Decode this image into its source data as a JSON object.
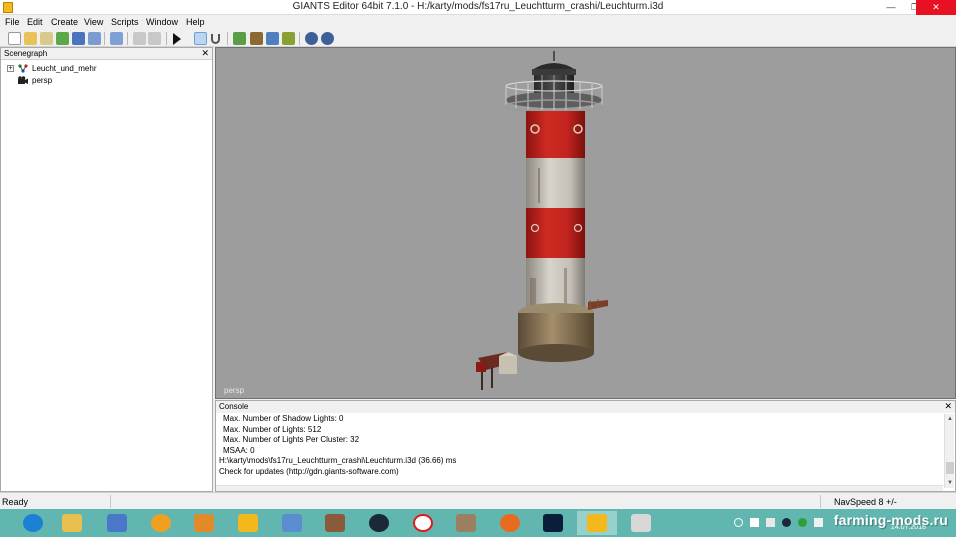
{
  "window": {
    "title": "GIANTS Editor 64bit 7.1.0 - H:/karty/mods/fs17ru_Leuchtturm_crashi/Leuchturm.i3d",
    "minimize_glyph": "—",
    "maximize_glyph": "❐",
    "close_glyph": "✕"
  },
  "menu": [
    {
      "label": "File"
    },
    {
      "label": "Edit"
    },
    {
      "label": "Create"
    },
    {
      "label": "View"
    },
    {
      "label": "Scripts"
    },
    {
      "label": "Window"
    },
    {
      "label": "Help"
    }
  ],
  "toolbar": {
    "icons": [
      "new-file-icon",
      "open-file-icon",
      "edit-file-icon",
      "refresh-icon",
      "save-icon",
      "export-icon",
      "history-icon",
      "undo-icon",
      "redo-icon",
      "play-icon",
      "select-icon",
      "magnet-icon",
      "terrain-icon",
      "paint-icon",
      "sculpt-icon",
      "foliage-icon",
      "settings-gear-icon",
      "settings-gear-2-icon"
    ]
  },
  "scenegraph": {
    "title": "Scenegraph",
    "close_glyph": "✕",
    "nodes": [
      {
        "label": "Leucht_und_mehr",
        "expander": "+",
        "icon": "transform-group-icon"
      },
      {
        "label": "persp",
        "icon": "camera-icon"
      }
    ]
  },
  "viewport": {
    "camera_label": "persp"
  },
  "console": {
    "title": "Console",
    "close_glyph": "✕",
    "lines": [
      "Max. Number of Shadow Lights: 0",
      "Max. Number of Lights: 512",
      "Max. Number of Lights Per Cluster: 32",
      "MSAA: 0",
      "H:\\karty\\mods\\fs17ru_Leuchtturm_crashi\\Leuchturm.i3d (36.66) ms",
      "Check for updates (http://gdn.giants-software.com)"
    ],
    "scroll_up_glyph": "▲",
    "scroll_down_glyph": "▼"
  },
  "status": {
    "ready": "Ready",
    "navspeed": "NavSpeed 8 +/-"
  },
  "taskbar": {
    "apps": [
      {
        "name": "ie",
        "icon": "internet-explorer-icon",
        "color": "#1e7fd6"
      },
      {
        "name": "explorer",
        "icon": "file-explorer-icon",
        "color": "#e8c050"
      },
      {
        "name": "paint",
        "icon": "paint-app-icon",
        "color": "#4a78c8"
      },
      {
        "name": "cloud",
        "icon": "cloud-app-icon",
        "color": "#f0a020"
      },
      {
        "name": "media",
        "icon": "media-player-icon",
        "color": "#e08a2a"
      },
      {
        "name": "giants1",
        "icon": "giants-editor-icon",
        "color": "#f2b81c"
      },
      {
        "name": "calculator",
        "icon": "calculator-icon",
        "color": "#5a8ed0"
      },
      {
        "name": "cube",
        "icon": "cube-app-icon",
        "color": "#8a5a3a"
      },
      {
        "name": "steam",
        "icon": "steam-icon",
        "color": "#1b2838"
      },
      {
        "name": "yandex",
        "icon": "yandex-browser-icon",
        "color": "#ffffff"
      },
      {
        "name": "paintbrush",
        "icon": "paintbrush-app-icon",
        "color": "#9a8060"
      },
      {
        "name": "firefox",
        "icon": "firefox-icon",
        "color": "#e86a20"
      },
      {
        "name": "photoshop",
        "icon": "photoshop-icon",
        "color": "#0a1e3a"
      },
      {
        "name": "giants2",
        "icon": "giants-editor-active-icon",
        "color": "#f2b81c",
        "active": true
      },
      {
        "name": "viewer",
        "icon": "image-viewer-icon",
        "color": "#d8d8d8"
      }
    ],
    "clock_date": "24.07.2018",
    "watermark": "farming-mods.ru"
  }
}
